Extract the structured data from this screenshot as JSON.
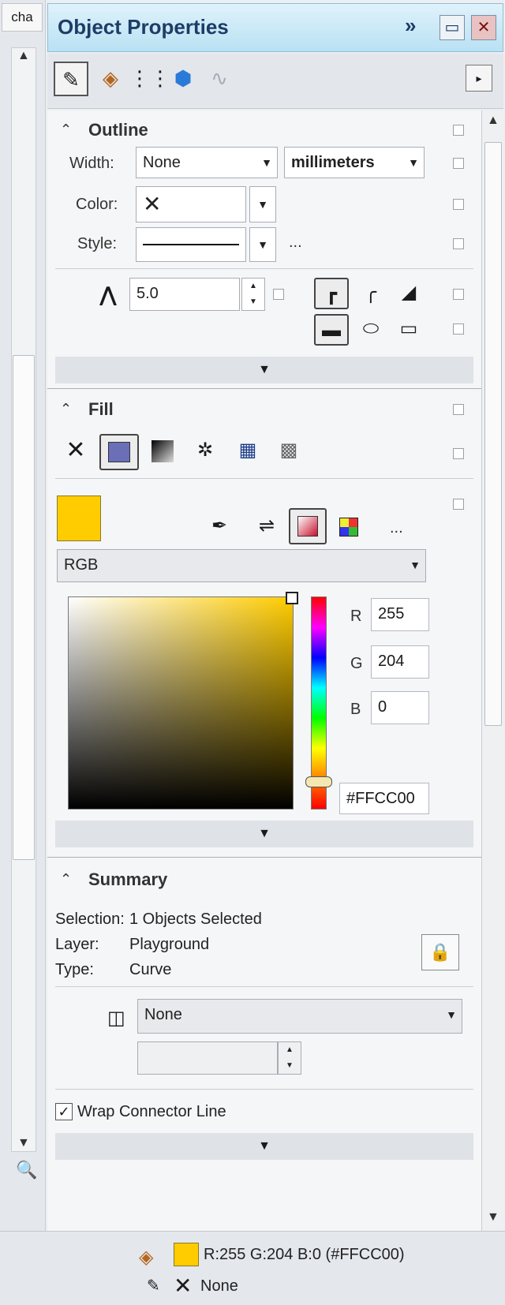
{
  "window": {
    "side_tab": "cha",
    "title": "Object Properties",
    "title_buttons": [
      "»"
    ]
  },
  "toolbar": {
    "tools": [
      "outline-pen-icon",
      "fill-bucket-icon",
      "transparency-icon",
      "web-globe-icon",
      "curve-icon"
    ]
  },
  "outline": {
    "header": "Outline",
    "width_label": "Width:",
    "width_value": "None",
    "units_value": "millimeters",
    "color_label": "Color:",
    "style_label": "Style:",
    "style_more": "...",
    "miter_value": "5.0"
  },
  "fill": {
    "header": "Fill",
    "more": "...",
    "color_model": "RGB",
    "r_label": "R",
    "r_value": "255",
    "g_label": "G",
    "g_value": "204",
    "b_label": "B",
    "b_value": "0",
    "hex_value": "#FFCC00",
    "swatch_color": "#ffcc00"
  },
  "summary": {
    "header": "Summary",
    "selection_label": "Selection:",
    "selection_value": "1 Objects Selected",
    "layer_label": "Layer:",
    "layer_value": "Playground",
    "type_label": "Type:",
    "type_value": "Curve",
    "style_dropdown_value": "None",
    "wrap_checkbox_label": "Wrap Connector Line",
    "wrap_checked": true
  },
  "status": {
    "fill_text": "R:255 G:204 B:0 (#FFCC00)",
    "outline_text": "None"
  }
}
